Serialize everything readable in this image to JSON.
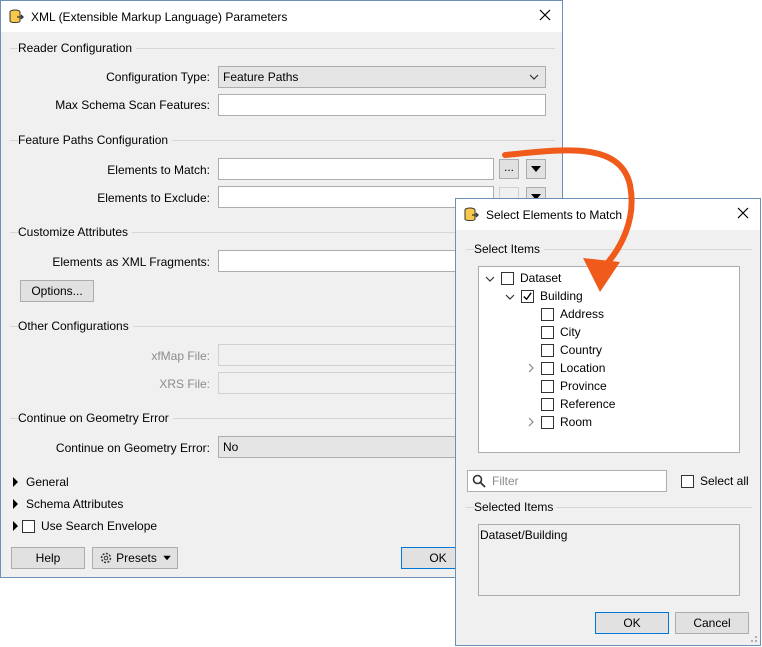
{
  "main_dialog": {
    "title": "XML (Extensible Markup Language) Parameters",
    "reader_config": {
      "group_label": "Reader Configuration",
      "config_type_label": "Configuration Type:",
      "config_type_value": "Feature Paths",
      "max_schema_label": "Max Schema Scan Features:",
      "max_schema_value": ""
    },
    "feature_paths": {
      "group_label": "Feature Paths Configuration",
      "match_label": "Elements to Match:",
      "match_value": "",
      "exclude_label": "Elements to Exclude:",
      "exclude_value": "",
      "ellipsis": "..."
    },
    "customize": {
      "group_label": "Customize Attributes",
      "fragments_label": "Elements as XML Fragments:",
      "options_label": "Options..."
    },
    "other": {
      "group_label": "Other Configurations",
      "xfmap_label": "xfMap File:",
      "xrs_label": "XRS File:"
    },
    "geometry": {
      "group_label": "Continue on Geometry Error",
      "field_label": "Continue on Geometry Error:",
      "value": "No"
    },
    "expanders": {
      "general": "General",
      "schema_attributes": "Schema Attributes",
      "search_envelope": "Use Search Envelope"
    },
    "buttons": {
      "help": "Help",
      "presets": "Presets",
      "ok": "OK"
    }
  },
  "select_dialog": {
    "title": "Select Elements to Match",
    "select_items_label": "Select Items",
    "tree": [
      {
        "label": "Dataset",
        "checked": false,
        "toggle": "expanded",
        "level": 0
      },
      {
        "label": "Building",
        "checked": true,
        "toggle": "expanded",
        "level": 1
      },
      {
        "label": "Address",
        "checked": false,
        "toggle": "none",
        "level": 2
      },
      {
        "label": "City",
        "checked": false,
        "toggle": "none",
        "level": 2
      },
      {
        "label": "Country",
        "checked": false,
        "toggle": "none",
        "level": 2
      },
      {
        "label": "Location",
        "checked": false,
        "toggle": "collapsed",
        "level": 2
      },
      {
        "label": "Province",
        "checked": false,
        "toggle": "none",
        "level": 2
      },
      {
        "label": "Reference",
        "checked": false,
        "toggle": "none",
        "level": 2
      },
      {
        "label": "Room",
        "checked": false,
        "toggle": "collapsed",
        "level": 2
      }
    ],
    "filter_placeholder": "Filter",
    "select_all_label": "Select all",
    "selected_items_label": "Selected Items",
    "selected_items_value": "Dataset/Building",
    "buttons": {
      "ok": "OK",
      "cancel": "Cancel"
    }
  },
  "colors": {
    "annotation_arrow": "#f05a1a",
    "window_border": "#6b8fb5",
    "dialog_bg": "#f0f0f0",
    "focus_border": "#0078d7"
  },
  "icons": {
    "app": "fme-reader-icon",
    "close": "close-icon",
    "dropdown": "chevron-down-icon",
    "search": "search-icon",
    "presets": "gear-icon"
  }
}
